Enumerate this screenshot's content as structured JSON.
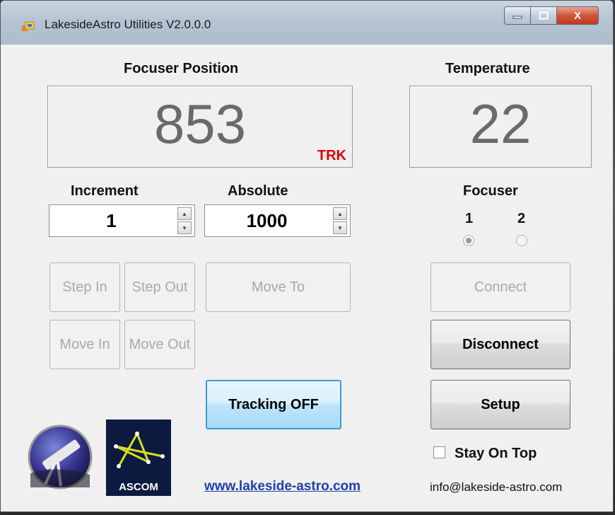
{
  "window": {
    "title": "LakesideAstro Utilities V2.0.0.0",
    "buttons": {
      "minimize_icon": "minimize-icon",
      "maximize_icon": "maximize-icon",
      "close_label": "X"
    }
  },
  "focuser_position": {
    "label": "Focuser Position",
    "value": "853",
    "badge": "TRK"
  },
  "temperature": {
    "label": "Temperature",
    "value": "22"
  },
  "increment": {
    "label": "Increment",
    "value": "1"
  },
  "absolute": {
    "label": "Absolute",
    "value": "1000"
  },
  "focuser_select": {
    "label": "Focuser",
    "options": [
      {
        "label": "1",
        "selected": true
      },
      {
        "label": "2",
        "selected": false
      }
    ]
  },
  "buttons": {
    "step_in": "Step In",
    "step_out": "Step Out",
    "move_to": "Move To",
    "move_in": "Move In",
    "move_out": "Move Out",
    "connect": "Connect",
    "disconnect": "Disconnect",
    "tracking": "Tracking OFF",
    "setup": "Setup"
  },
  "stay_on_top": {
    "label": "Stay On Top",
    "checked": false
  },
  "logos": {
    "ascom": "ASCOM"
  },
  "footer": {
    "website": "www.lakeside-astro.com",
    "email": "info@lakeside-astro.com"
  },
  "colors": {
    "badge": "#e00000",
    "link": "#1f3fa8",
    "focus_border": "#3c99d8"
  }
}
